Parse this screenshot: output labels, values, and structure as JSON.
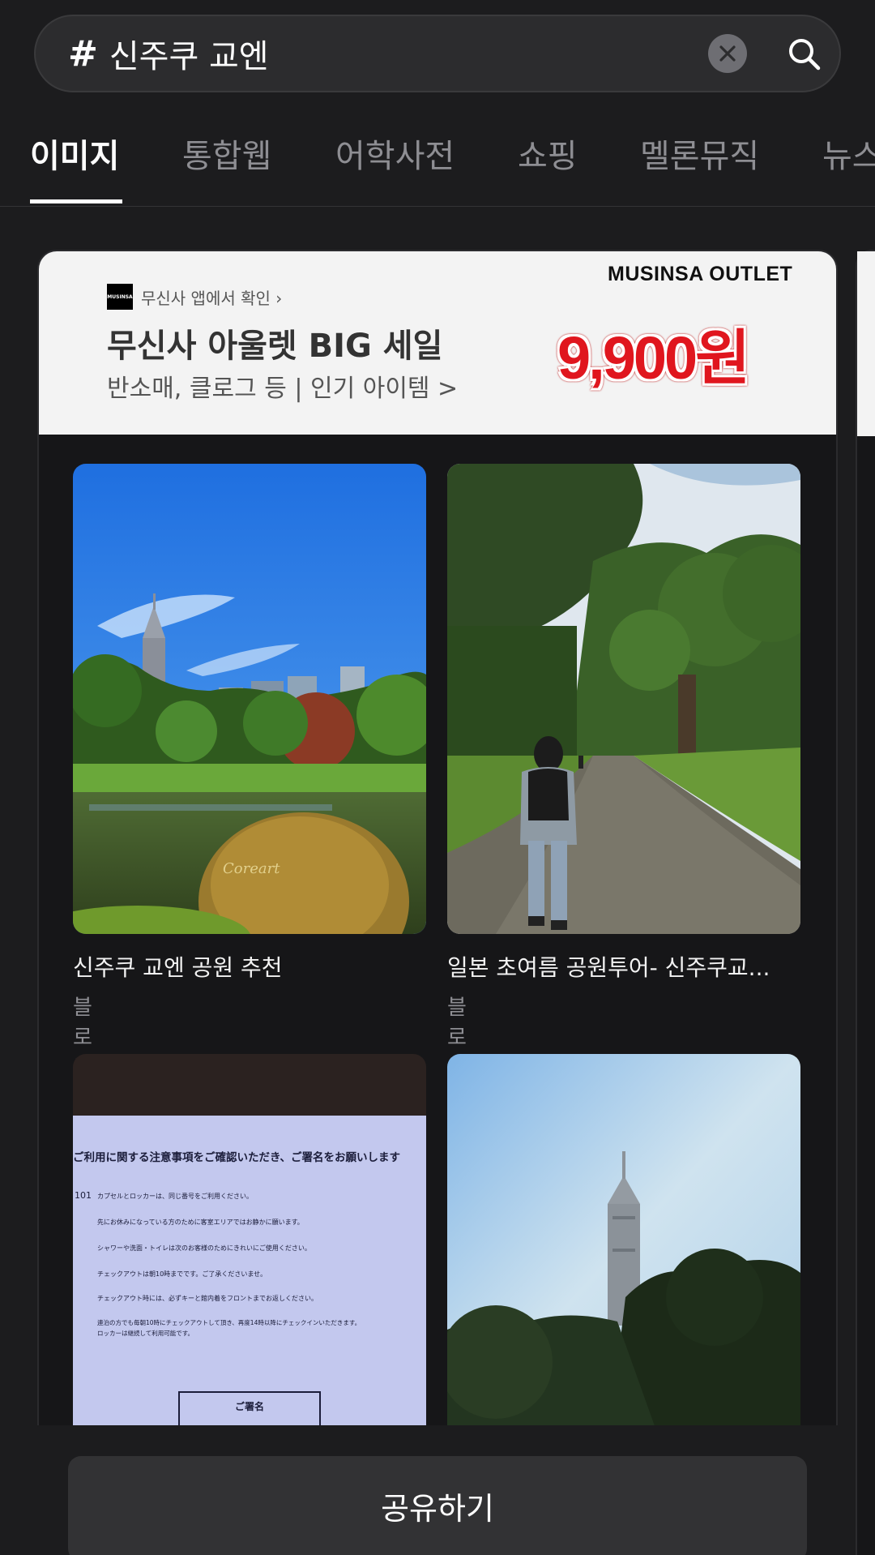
{
  "search": {
    "hash_symbol": "#",
    "query": "신주쿠 교엔"
  },
  "tabs": [
    {
      "label": "이미지",
      "active": true
    },
    {
      "label": "통합웹",
      "active": false
    },
    {
      "label": "어학사전",
      "active": false
    },
    {
      "label": "쇼핑",
      "active": false
    },
    {
      "label": "멜론뮤직",
      "active": false
    },
    {
      "label": "뉴스",
      "active": false
    }
  ],
  "ad": {
    "logo_text": "MUSINSA",
    "source": "무신사 앱에서 확인 ›",
    "title": "무신사 아울렛 BIG 세일",
    "subtitle": "반소매, 클로그 등 | 인기 아이템 >",
    "brand": "MUSINSA OUTLET",
    "price": "9,900원",
    "price_color": "#e0161e"
  },
  "results": [
    {
      "title": "신주쿠 교엔 공원 추천",
      "source": "블로그",
      "watermark": "Coreart"
    },
    {
      "title": "일본 초여름 공원투어- 신주쿠교...",
      "source": "블로그"
    }
  ],
  "sign_sheet": {
    "heading": "ご利用に関する注意事項をご確認いただき、ご署名をお願いします",
    "room": "101",
    "lines": [
      "カプセルとロッカーは、同じ番号をご利用ください。",
      "先にお休みになっている方のために客室エリアではお静かに願います。",
      "シャワーや洗面・トイレは次のお客様のためにきれいにご使用ください。",
      "チェックアウトは朝10時までです。ご了承くださいませ。",
      "チェックアウト時には、必ずキーと館内着をフロントまでお返しください。",
      "連泊の方でも毎朝10時にチェックアウトして頂き、再度14時以降にチェックインいただきます。",
      "ロッカーは継続して利用可能です。"
    ],
    "signature_label": "ご署名"
  },
  "share": {
    "label": "공유하기"
  }
}
